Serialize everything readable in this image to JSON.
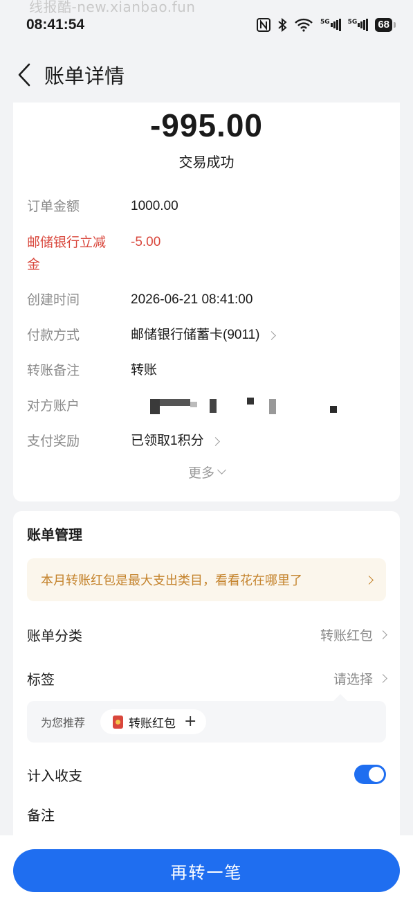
{
  "watermark_top": "线报酷-new.xianbao.fun",
  "status_bar": {
    "time": "08:41:54",
    "battery": "68",
    "net1": "5G",
    "net2": "5G"
  },
  "header": {
    "title": "账单详情"
  },
  "summary": {
    "amount": "-995.00",
    "status": "交易成功"
  },
  "details": [
    {
      "label": "订单金额",
      "value": "1000.00"
    },
    {
      "label": "邮储银行立减金",
      "value": "-5.00"
    },
    {
      "label": "创建时间",
      "value": "2026-06-21 08:41:00"
    },
    {
      "label": "付款方式",
      "value": "邮储银行储蓄卡(9011)"
    },
    {
      "label": "转账备注",
      "value": "转账"
    },
    {
      "label": "对方账户",
      "value": ""
    },
    {
      "label": "支付奖励",
      "value": "已领取1积分"
    }
  ],
  "more_label": "更多",
  "management": {
    "title": "账单管理",
    "promo": "本月转账红包是最大支出类目，看看花在哪里了",
    "category_label": "账单分类",
    "category_value": "转账红包",
    "tag_label": "标签",
    "tag_value": "请选择",
    "recommend_label": "为您推荐",
    "recommend_chip": "转账红包",
    "include_label": "计入收支",
    "include_on": true,
    "note_label": "备注"
  },
  "cta_label": "再转一笔",
  "colors": {
    "accent": "#1f6ef0",
    "discount_red": "#d9473c",
    "promo_text": "#c4832c"
  }
}
